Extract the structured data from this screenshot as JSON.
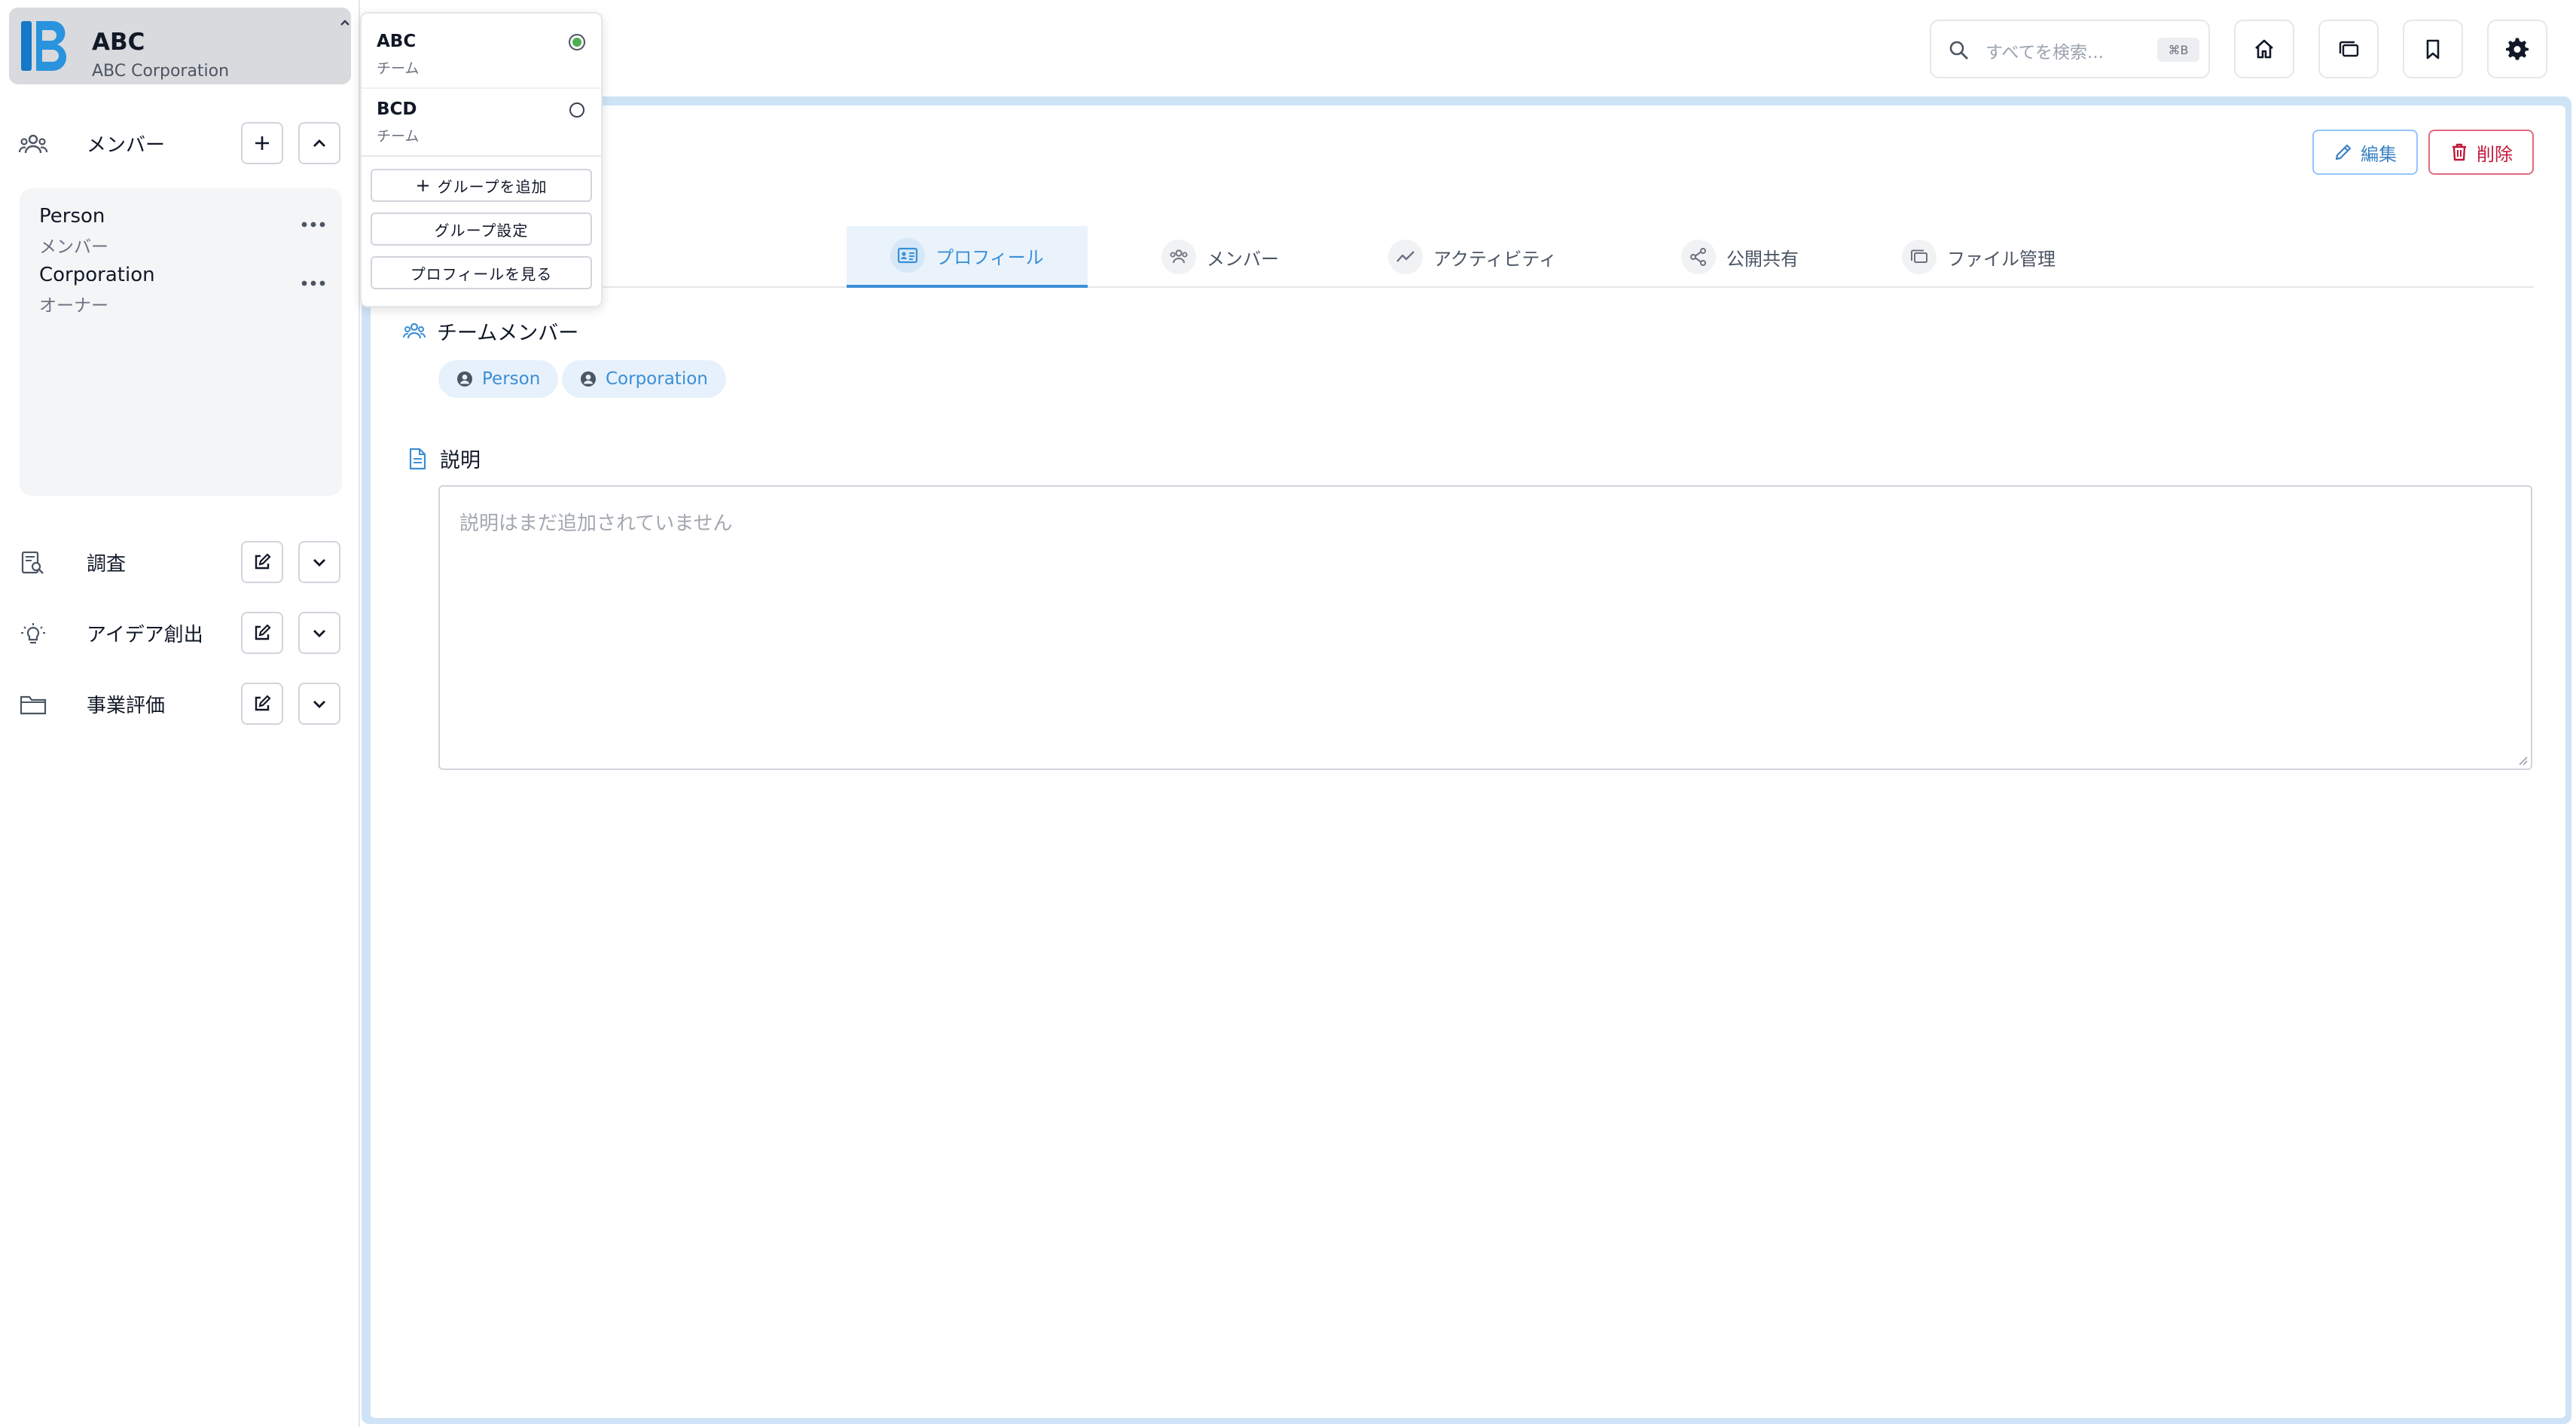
{
  "org": {
    "name": "ABC",
    "subtitle": "ABC Corporation"
  },
  "sidebar": {
    "members_section": {
      "label": "メンバー"
    },
    "members": [
      {
        "name": "Person",
        "role": "メンバー"
      },
      {
        "name": "Corporation",
        "role": "オーナー"
      }
    ],
    "sections": [
      {
        "label": "調査",
        "icon": "research-icon"
      },
      {
        "label": "アイデア創出",
        "icon": "lightbulb-icon"
      },
      {
        "label": "事業評価",
        "icon": "folder-icon"
      }
    ]
  },
  "group_dropdown": {
    "groups": [
      {
        "name": "ABC",
        "type": "チーム",
        "selected": true
      },
      {
        "name": "BCD",
        "type": "チーム",
        "selected": false
      }
    ],
    "add_group": "グループを追加",
    "group_settings": "グループ設定",
    "view_profile": "プロフィールを見る"
  },
  "topbar": {
    "search_placeholder": "すべてを検索...",
    "search_shortcut": "⌘B",
    "icons": [
      "home-icon",
      "stack-icon",
      "bookmark-icon",
      "gear-icon"
    ]
  },
  "main": {
    "edit_label": "編集",
    "delete_label": "削除",
    "tabs": [
      {
        "label": "プロフィール",
        "active": true
      },
      {
        "label": "メンバー",
        "active": false
      },
      {
        "label": "アクティビティ",
        "active": false
      },
      {
        "label": "公開共有",
        "active": false
      },
      {
        "label": "ファイル管理",
        "active": false
      }
    ],
    "team_members_heading": "チームメンバー",
    "chips": [
      "Person",
      "Corporation"
    ],
    "description_heading": "説明",
    "description_placeholder": "説明はまだ追加されていません"
  },
  "colors": {
    "accent": "#3b8fd6",
    "danger": "#c0183a",
    "selected_radio": "#4caf50"
  }
}
